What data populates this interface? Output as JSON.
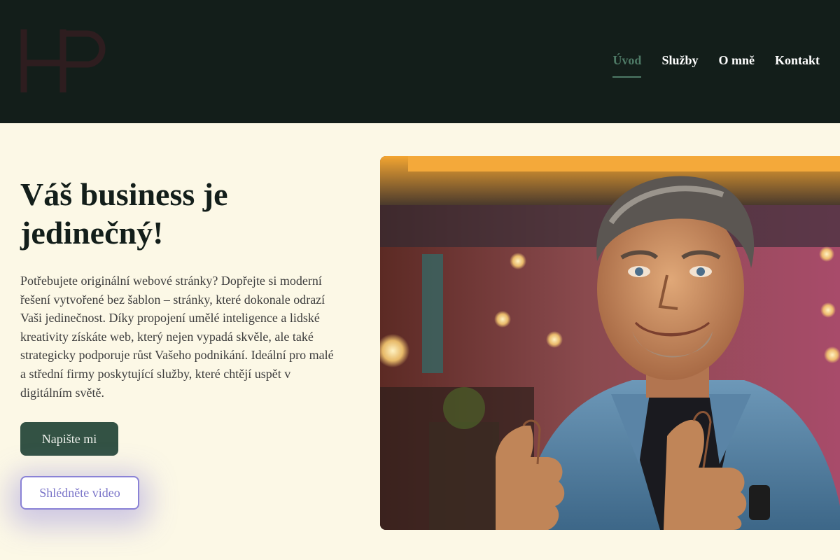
{
  "header": {
    "logo_text": "HP",
    "nav": [
      {
        "label": "Úvod",
        "active": true
      },
      {
        "label": "Služby",
        "active": false
      },
      {
        "label": "O mně",
        "active": false
      },
      {
        "label": "Kontakt",
        "active": false
      }
    ]
  },
  "hero": {
    "title": "Váš business je jedinečný!",
    "text": "Potřebujete originální webové stránky? Dopřejte si moderní řešení vytvořené bez šablon – stránky, které dokonale odrazí Vaši jedinečnost. Díky propojení umělé inteligence a lidské kreativity získáte web, který nejen vypadá skvěle, ale také strategicky podporuje růst Vašeho podnikání. Ideální pro malé a střední firmy poskytující služby, které chtějí uspět v digitálním světě.",
    "primary_button": "Napište mi",
    "secondary_button": "Shlédněte video"
  },
  "colors": {
    "header_bg": "#131e1a",
    "page_bg": "#fcf8e6",
    "accent": "#4e7a66",
    "button_primary": "#335244",
    "button_secondary_border": "#8a82d6"
  }
}
